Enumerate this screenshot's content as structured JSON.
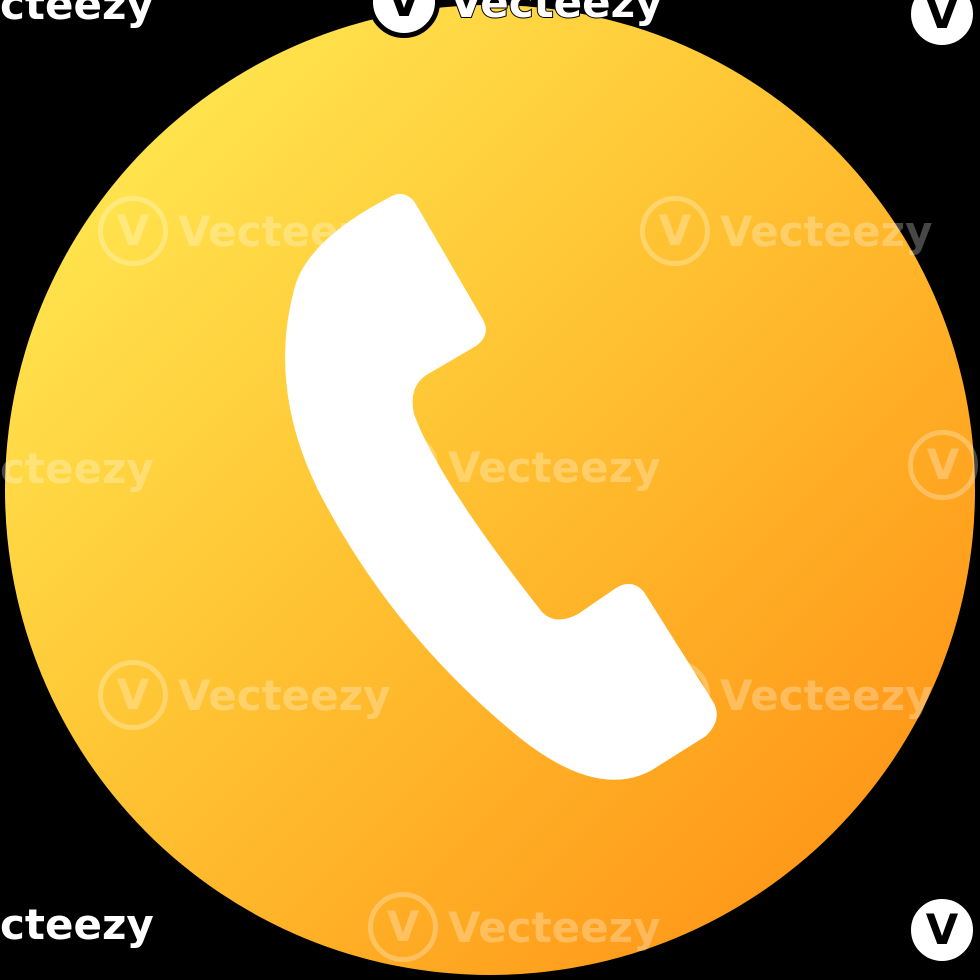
{
  "icon": {
    "name": "phone-handset-icon",
    "gradient_start": "#FFF25A",
    "gradient_mid": "#FFC433",
    "gradient_end": "#FF8A10",
    "glyph_color": "#FFFFFF",
    "background_color": "#000000"
  },
  "watermark": {
    "brand": "Vecteezy",
    "logo_letter": "V",
    "clipped_text": "cteezy"
  }
}
